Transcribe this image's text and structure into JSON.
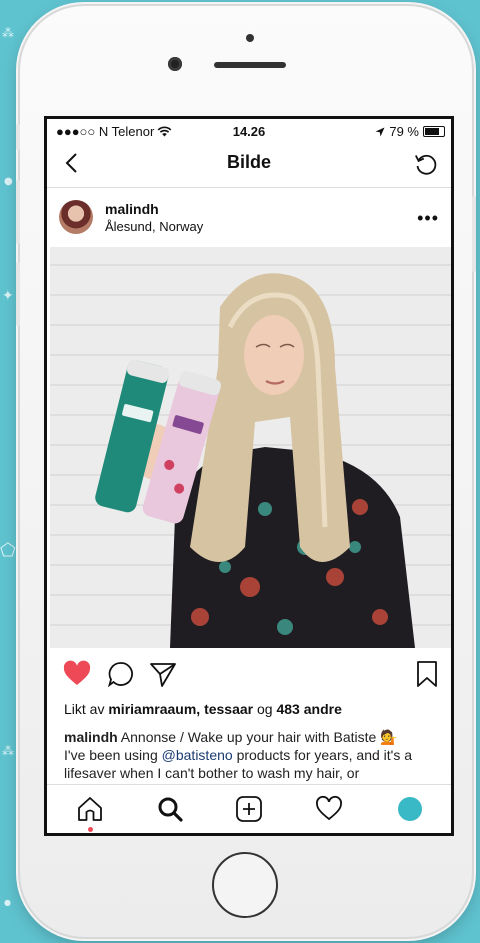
{
  "status_bar": {
    "carrier": "●●●○○ N Telenor",
    "time": "14.26",
    "battery": "79 %",
    "battery_level": 0.79
  },
  "nav": {
    "title": "Bilde"
  },
  "post": {
    "username": "malindh",
    "location": "Ålesund, Norway",
    "more": "•••",
    "likes": {
      "prefix": "Likt av ",
      "users": "miriamraaum, tessaar",
      "joiner": " og ",
      "others": "483 andre"
    },
    "caption": {
      "username": "malindh",
      "text_1": " Annonse / Wake up your hair with Batiste 💁",
      "text_2": "I've been using ",
      "mention": "@batisteno",
      "text_3": " products for years, and it's a lifesaver when I can't bother to wash my hair, or"
    },
    "liked": true
  },
  "colors": {
    "background": "#5fc3cf",
    "like_red": "#ed4956",
    "mention": "#1b3b72",
    "profile_teal": "#39b8c6"
  },
  "icons": {
    "back": "chevron-left-icon",
    "refresh": "refresh-icon",
    "like": "heart-icon",
    "comment": "comment-icon",
    "share": "send-icon",
    "save": "bookmark-icon",
    "home": "home-icon",
    "search": "search-icon",
    "add": "add-post-icon",
    "activity": "heart-outline-icon",
    "profile": "profile-avatar-icon"
  }
}
